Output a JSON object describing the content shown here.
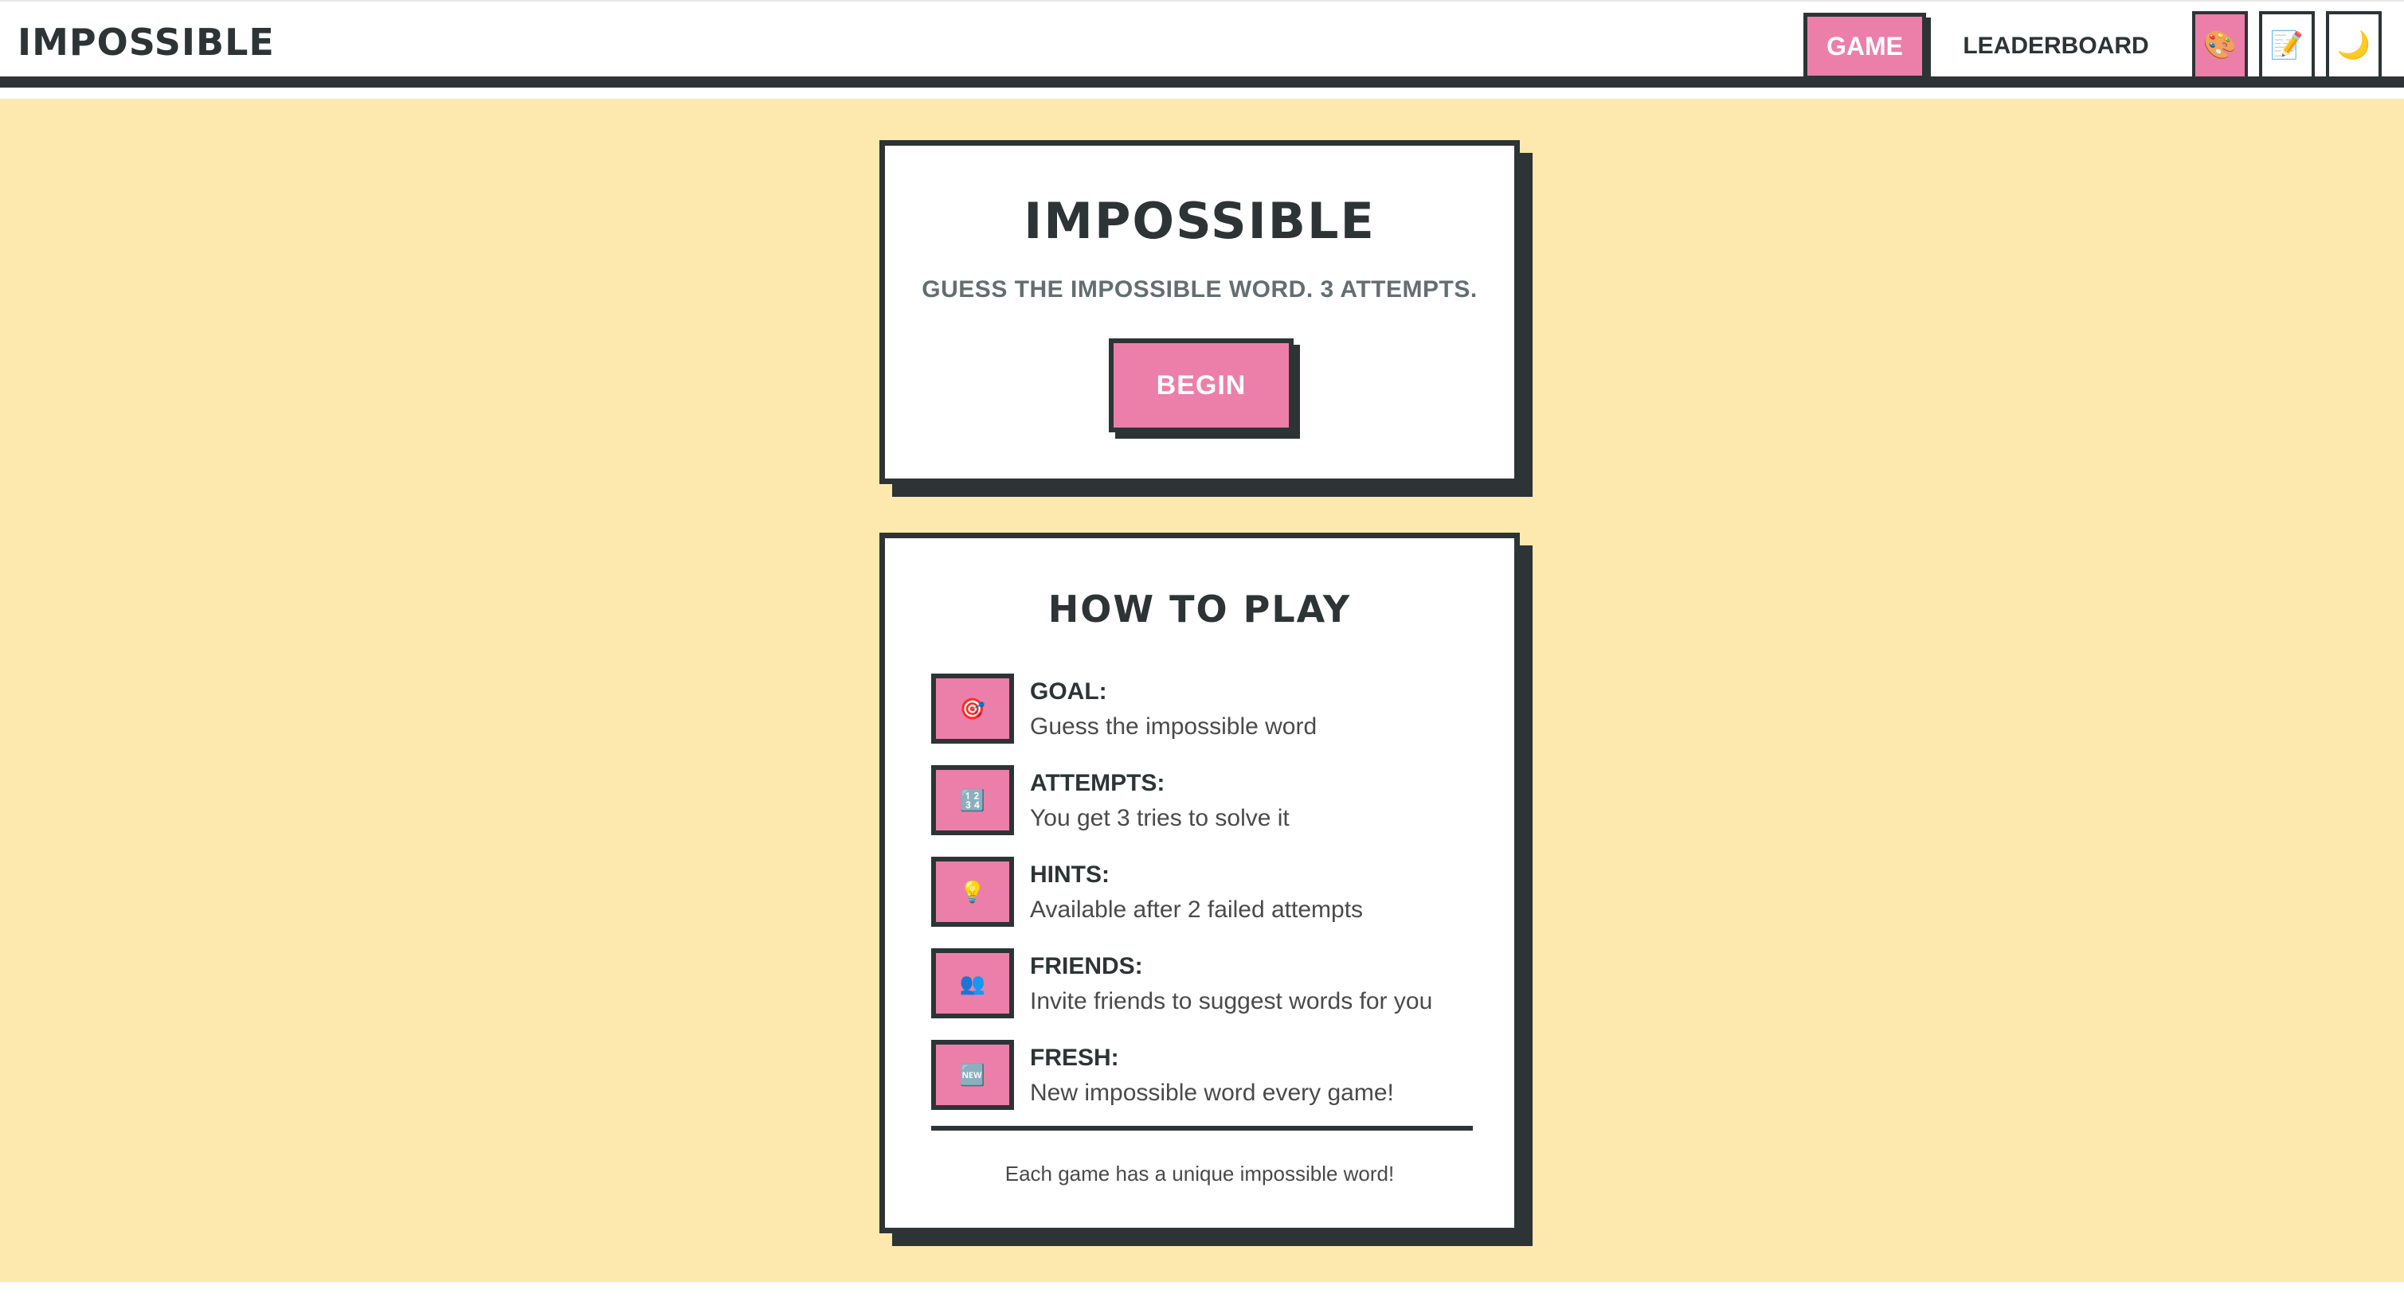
{
  "header": {
    "brand": "IMPOSSIBLE",
    "nav": {
      "game": "GAME",
      "leaderboard": "LEADERBOARD"
    },
    "icon_buttons": [
      {
        "icon": "palette-icon",
        "glyph": "🎨"
      },
      {
        "icon": "memo-icon",
        "glyph": "📝"
      },
      {
        "icon": "moon-icon",
        "glyph": "🌙"
      }
    ]
  },
  "game_card": {
    "title": "IMPOSSIBLE",
    "subtitle": "GUESS THE IMPOSSIBLE WORD. 3 ATTEMPTS.",
    "begin_label": "BEGIN"
  },
  "how_to_play": {
    "title": "HOW TO PLAY",
    "rules": [
      {
        "icon": "target-icon",
        "glyph": "🎯",
        "label": "GOAL:",
        "desc": "Guess the impossible word"
      },
      {
        "icon": "numbers-icon",
        "glyph": "🔢",
        "label": "ATTEMPTS:",
        "desc": "You get 3 tries to solve it"
      },
      {
        "icon": "lightbulb-icon",
        "glyph": "💡",
        "label": "HINTS:",
        "desc": "Available after 2 failed attempts"
      },
      {
        "icon": "people-icon",
        "glyph": "👥",
        "label": "FRIENDS:",
        "desc": "Invite friends to suggest words for you"
      },
      {
        "icon": "new-icon",
        "glyph": "🆕",
        "label": "FRESH:",
        "desc": "New impossible word every game!"
      }
    ],
    "footer": "Each game has a unique impossible word!"
  },
  "colors": {
    "accent_pink": "#ec7fa9",
    "ink": "#2d3436",
    "background": "#fde9ad"
  }
}
